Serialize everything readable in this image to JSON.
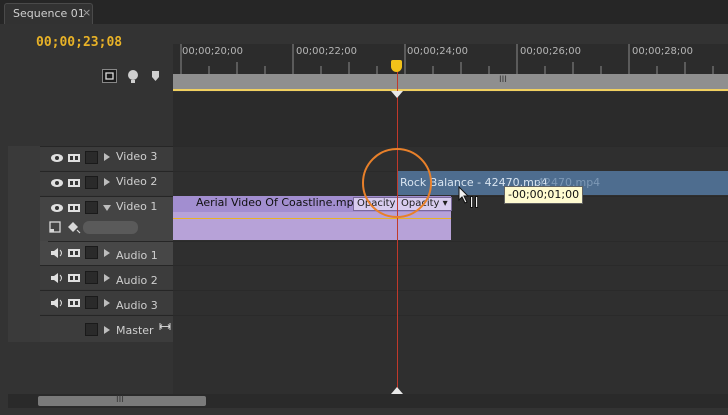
{
  "tab": {
    "label": "Sequence 01",
    "close": "×"
  },
  "timecode": "00;00;23;08",
  "ruler": {
    "ticks": [
      "00;00;20;00",
      "00;00;22;00",
      "00;00;24;00",
      "00;00;26;00",
      "00;00;28;00"
    ]
  },
  "tracks": {
    "video3": "Video 3",
    "video2": "Video 2",
    "video1": "Video 1",
    "audio1": "Audio 1",
    "audio2": "Audio 2",
    "audio3": "Audio 3",
    "master": "Master"
  },
  "clips": {
    "v1_name": "Aerial Video Of Coastline.mp4",
    "v1_opacity1": "Opacity",
    "v1_opacity2": "Opacity ▾",
    "v2_name": "Rock Balance - 42470.mp4",
    "v2_ghost": "42470.mp4"
  },
  "tooltip": "-00;00;01;00",
  "zoombar_grip": "III",
  "scroll_grip": "III",
  "colors": {
    "timecode": "#e8b227",
    "playhead": "#c0392b",
    "video_clip": "#b7a2d8",
    "video2_clip": "#4e6d8f",
    "highlight": "#e8802a"
  }
}
